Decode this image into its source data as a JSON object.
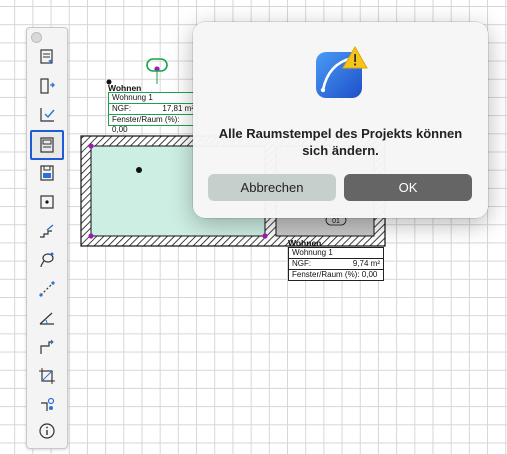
{
  "palette": {
    "tools": [
      {
        "name": "settings-sheet-icon"
      },
      {
        "name": "door-tool-icon"
      },
      {
        "name": "check-list-icon"
      },
      {
        "name": "room-stamp-icon",
        "selected": true
      },
      {
        "name": "save-stamp-icon"
      },
      {
        "name": "point-tool-icon"
      },
      {
        "name": "stairs-pen-icon"
      },
      {
        "name": "lasso-tool-icon"
      },
      {
        "name": "path-tool-icon"
      },
      {
        "name": "angle-measure-icon"
      },
      {
        "name": "step-line-icon"
      },
      {
        "name": "crop-area-icon"
      },
      {
        "name": "node-connect-icon"
      },
      {
        "name": "info-icon"
      }
    ]
  },
  "plan": {
    "stamp_upper": {
      "title": "Wohnen",
      "row1": "Wohnung 1",
      "row2_label": "NGF:",
      "row2_value": "17,81 m²",
      "row3": "Fenster/Raum (%): 0,00"
    },
    "stamp_lower": {
      "title": "Wohnen",
      "row1": "Wohnung 1",
      "row2_label": "NGF:",
      "row2_value": "9,74 m²",
      "row3": "Fenster/Raum (%): 0,00"
    },
    "room_number": "01"
  },
  "dialog": {
    "message": "Alle Raumstempel des Projekts können sich ändern.",
    "cancel_label": "Abbrechen",
    "ok_label": "OK"
  },
  "colors": {
    "accent": "#1e5bd6",
    "room_fill": "#cdeee2",
    "ok_button": "#656565",
    "cancel_button": "#c7cfcc",
    "stamp_green": "#1aa34a"
  }
}
